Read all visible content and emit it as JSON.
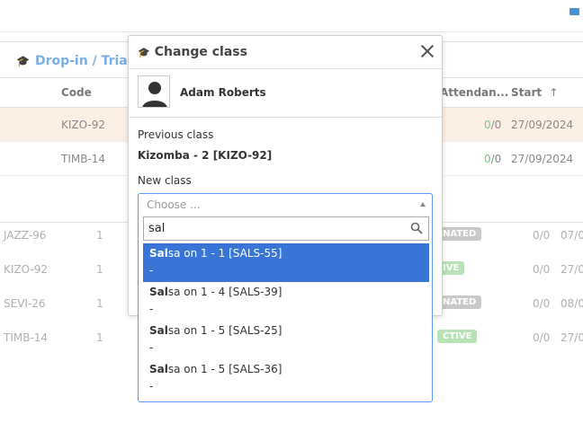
{
  "background": {
    "section_title": "Drop-in / Trials",
    "columns": {
      "code": "Code",
      "attendance": "Attendan...",
      "start": "Start"
    },
    "rows": [
      {
        "code": "KIZO-92",
        "att_a": "0",
        "att_b": "/0",
        "start": "27/09/2024"
      },
      {
        "code": "TIMB-14",
        "att_a": "0",
        "att_b": "/0",
        "start": "27/09/2024"
      }
    ],
    "lower_rows": [
      {
        "code": "JAZZ-96",
        "count": "1",
        "badge": "NATED",
        "att": "0/0",
        "date": "07/0"
      },
      {
        "code": "KIZO-92",
        "count": "1",
        "badge": "IVE",
        "att": "0/0",
        "date": "27/0"
      },
      {
        "code": "SEVI-26",
        "count": "1",
        "badge": "NATED",
        "att": "0/0",
        "date": "08/0"
      },
      {
        "code": "TIMB-14",
        "count": "1",
        "badge": "CTIVE",
        "att": "0/0",
        "date": "27/0"
      }
    ]
  },
  "modal": {
    "title": "Change class",
    "user_name": "Adam Roberts",
    "previous_class_label": "Previous class",
    "previous_class_value": "Kizomba - 2 [KIZO-92]",
    "new_class_label": "New class",
    "select_placeholder": "Choose ...",
    "search_value": "sal",
    "results": [
      {
        "match": "Sal",
        "rest": "sa on 1 - 1 [SALS-55]",
        "sub": "-"
      },
      {
        "match": "Sal",
        "rest": "sa on 1 - 4 [SALS-39]",
        "sub": "-"
      },
      {
        "match": "Sal",
        "rest": "sa on 1 - 5 [SALS-25]",
        "sub": "-"
      },
      {
        "match": "Sal",
        "rest": "sa on 1 - 5 [SALS-36]",
        "sub": "-"
      }
    ]
  },
  "colors": {
    "accent": "#3875d7",
    "section_title": "#78aee0",
    "attendance_green": "#7cc47f",
    "highlight_row": "#fcefe4"
  }
}
